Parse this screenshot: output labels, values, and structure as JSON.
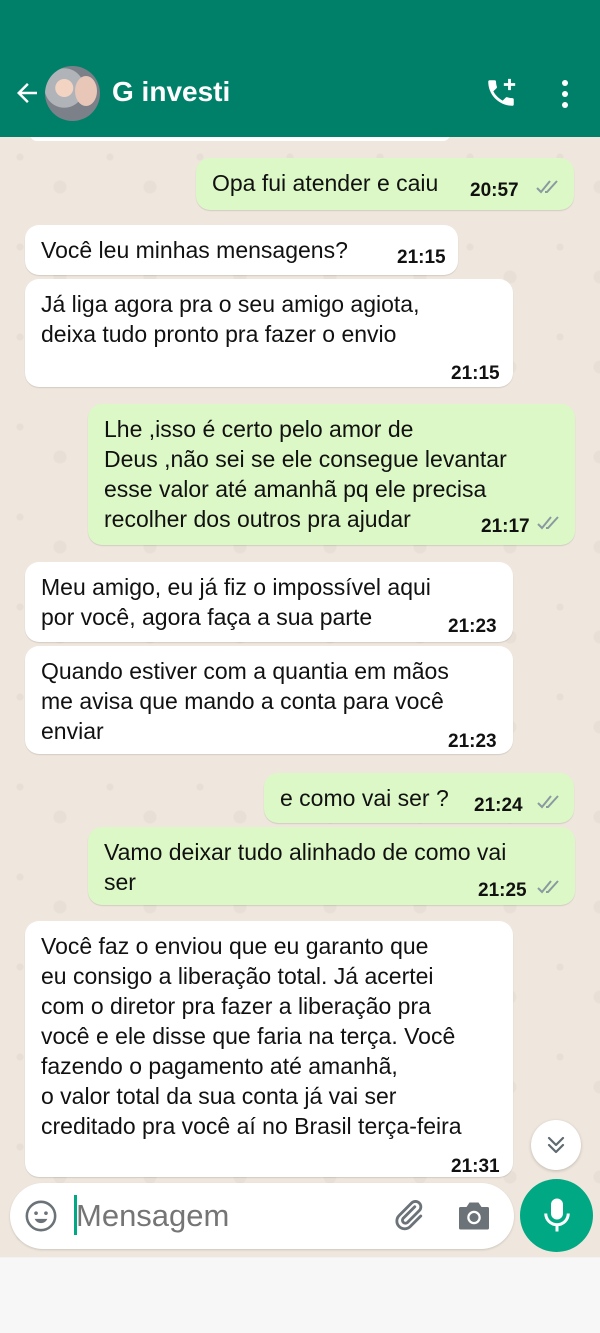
{
  "header": {
    "title": "G investi",
    "icons": {
      "back": "arrow-left-icon",
      "call": "add-call-icon",
      "menu": "more-vertical-icon"
    },
    "background": "#008069"
  },
  "messages": [
    {
      "dir": "out",
      "text": "Opa fui atender e caiu",
      "time": "20:57",
      "read": true
    },
    {
      "dir": "in",
      "text": "Você leu minhas mensagens?",
      "time": "21:15"
    },
    {
      "dir": "in",
      "text": "Já liga agora pra o seu amigo agiota,\ndeixa tudo pronto pra fazer o envio",
      "time": "21:15"
    },
    {
      "dir": "out",
      "text": "Lhe ,isso é certo pelo amor de\nDeus ,não sei se ele consegue levantar\nesse valor até amanhã pq ele precisa\nrecolher dos outros pra ajudar",
      "time": "21:17",
      "read": true
    },
    {
      "dir": "in",
      "text": "Meu amigo, eu já fiz o impossível aqui\npor você, agora faça a sua parte",
      "time": "21:23"
    },
    {
      "dir": "in",
      "text": "Quando estiver com a quantia em mãos\nme avisa que mando a conta para você\nenviar",
      "time": "21:23"
    },
    {
      "dir": "out",
      "text": "e como vai ser ?",
      "time": "21:24",
      "read": true
    },
    {
      "dir": "out",
      "text": "Vamo deixar tudo alinhado de como vai\nser",
      "time": "21:25",
      "read": true
    },
    {
      "dir": "in",
      "text": "Você faz o enviou que eu garanto que\neu consigo a liberação total. Já acertei\ncom o diretor pra fazer a liberação pra\nvocê e ele disse que faria na terça. Você\nfazendo o pagamento até amanhã,\no valor total da sua conta já vai ser\ncreditado pra você aí no Brasil terça-feira",
      "time": "21:31"
    }
  ],
  "composer": {
    "placeholder": "Mensagem",
    "icons": {
      "emoji": "emoji-icon",
      "attach": "paperclip-icon",
      "camera": "camera-icon",
      "mic": "mic-icon",
      "scroll": "double-chevron-down-icon"
    }
  },
  "colors": {
    "accent": "#00a884",
    "outgoing": "#dcf8c6",
    "incoming": "#ffffff",
    "chat_bg": "#efe7dd"
  }
}
